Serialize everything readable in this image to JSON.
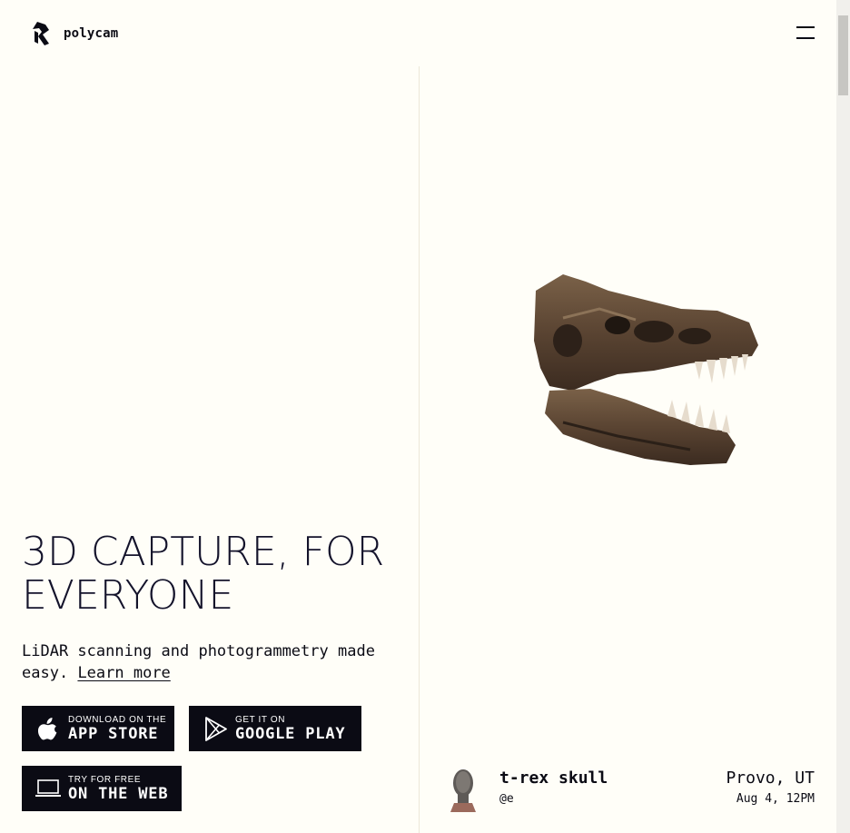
{
  "header": {
    "logo_text": "polycam",
    "logo_icon": "polycam-logo-icon",
    "menu_icon": "hamburger-menu-icon"
  },
  "hero": {
    "title": "3D CAPTURE, FOR EVERYONE",
    "subtitle": "LiDAR scanning and photogrammetry made easy.",
    "learn_more": "Learn more"
  },
  "buttons": {
    "appstore": {
      "small": "DOWNLOAD ON THE",
      "big": "APP STORE",
      "icon": "apple-icon"
    },
    "google": {
      "small": "GET IT ON",
      "big": "GOOGLE PLAY",
      "icon": "play-store-icon"
    },
    "web": {
      "small": "TRY FOR FREE",
      "big": "ON THE WEB",
      "icon": "laptop-icon"
    }
  },
  "featured_capture": {
    "title": "t-rex skull",
    "user": "@e",
    "location": "Provo, UT",
    "date": "Aug 4, 12PM"
  },
  "colors": {
    "background": "#fffef8",
    "text": "#0b0b14",
    "button_bg": "#0b0b14"
  }
}
